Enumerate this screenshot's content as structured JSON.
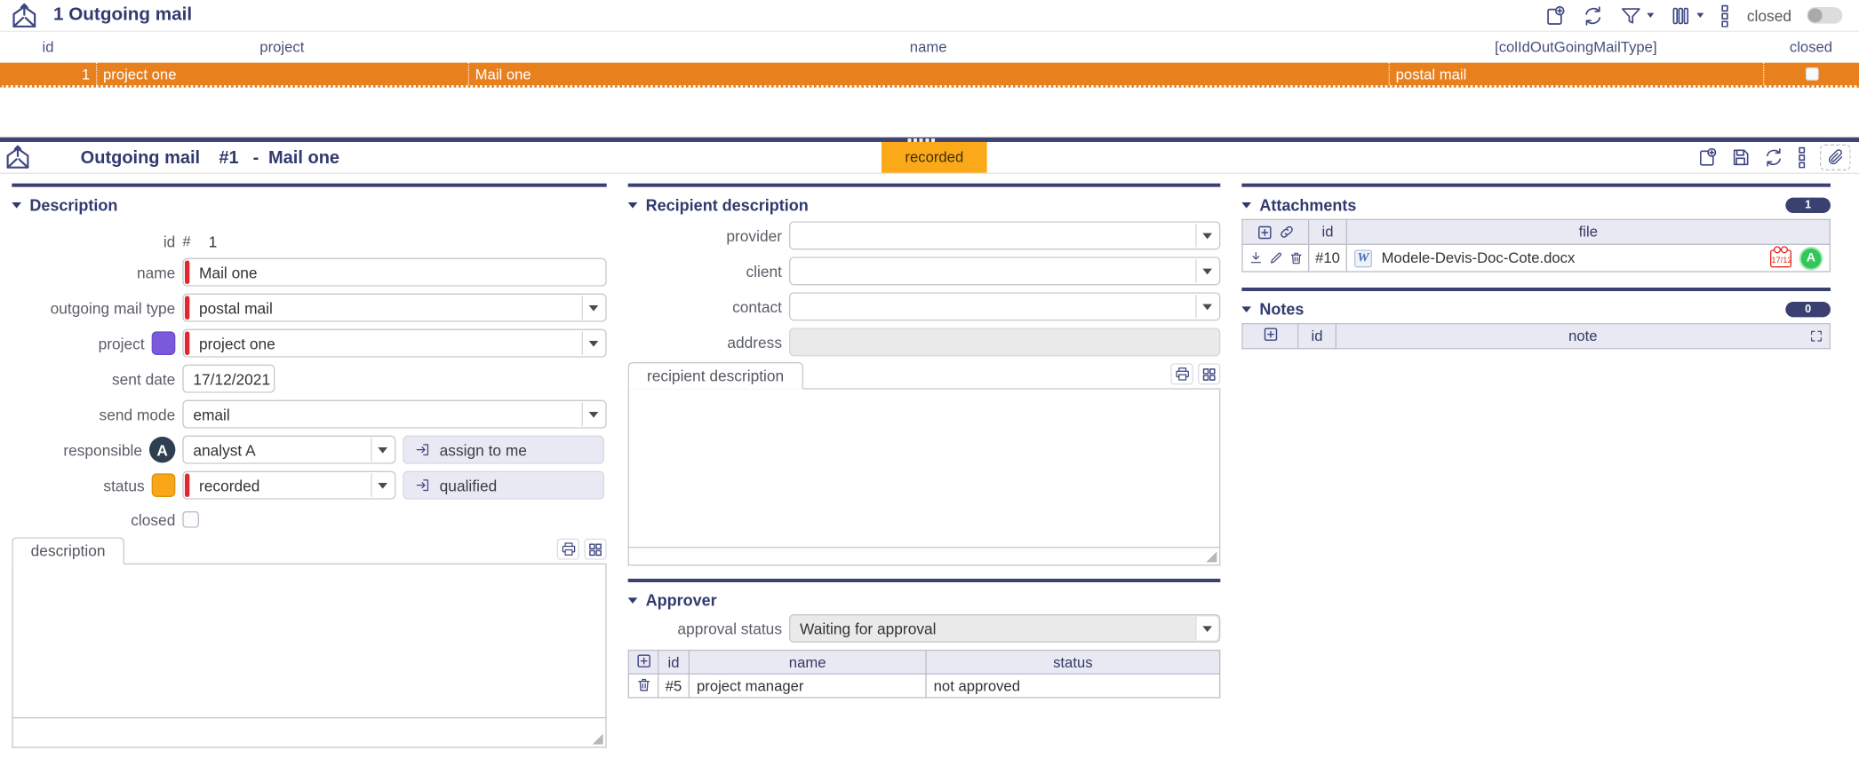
{
  "colors": {
    "accent_navy": "#3a4170",
    "row_orange": "#e8801e",
    "status_orange": "#fba919",
    "project_purple": "#7a5ad8",
    "avatar_green": "#33c759",
    "calendar_red": "#e02b20",
    "required_red": "#e0282e"
  },
  "list_view": {
    "title": "1 Outgoing mail",
    "toolbar": {
      "closed_label": "closed",
      "closed_toggle_on": false
    },
    "columns": [
      "id",
      "project",
      "name",
      "[colIdOutGoingMailType]",
      "closed"
    ],
    "row": {
      "id": "1",
      "project": "project one",
      "name": "Mail one",
      "mail_type": "postal mail",
      "closed": false
    }
  },
  "form_view": {
    "title_prefix": "Outgoing mail",
    "record_id": "#1",
    "title_separator": "-",
    "record_name": "Mail one",
    "status_badge": "recorded"
  },
  "description": {
    "title": "Description",
    "id_label": "id",
    "id_hash": "#",
    "id_value": "1",
    "name_label": "name",
    "name_value": "Mail one",
    "mail_type_label": "outgoing mail type",
    "mail_type_value": "postal mail",
    "project_label": "project",
    "project_value": "project one",
    "sent_date_label": "sent date",
    "sent_date_value": "17/12/2021",
    "send_mode_label": "send mode",
    "send_mode_value": "email",
    "responsible_label": "responsible",
    "responsible_value": "analyst A",
    "responsible_initial": "A",
    "assign_button": "assign to me",
    "status_label": "status",
    "status_value": "recorded",
    "qualified_button": "qualified",
    "closed_label": "closed",
    "closed_checked": false,
    "notebook_tab": "description"
  },
  "recipient": {
    "title": "Recipient description",
    "provider_label": "provider",
    "provider_value": "",
    "client_label": "client",
    "client_value": "",
    "contact_label": "contact",
    "contact_value": "",
    "address_label": "address",
    "address_value": "",
    "notebook_tab": "recipient description"
  },
  "approver": {
    "title": "Approver",
    "approval_status_label": "approval status",
    "approval_status_value": "Waiting for approval",
    "columns": {
      "id": "id",
      "name": "name",
      "status": "status"
    },
    "rows": [
      {
        "id": "#5",
        "name": "project manager",
        "status": "not approved"
      }
    ]
  },
  "attachments": {
    "title": "Attachments",
    "count_badge": "1",
    "columns": {
      "id": "id",
      "file": "file"
    },
    "rows": [
      {
        "id": "#10",
        "file": "Modele-Devis-Doc-Cote.docx",
        "file_type_letter": "W",
        "date_badge": "17/12",
        "user_initial": "A"
      }
    ]
  },
  "notes": {
    "title": "Notes",
    "count_badge": "0",
    "columns": {
      "id": "id",
      "note": "note"
    }
  },
  "icons": {
    "new_record": "page-plus",
    "refresh": "circular-arrows",
    "filter": "funnel",
    "columns_picker": "vertical-bars",
    "more_menu": "stacked-squares",
    "save": "floppy-disk",
    "attachment": "paperclip",
    "print": "printer",
    "expand": "grid-squares",
    "add": "plus-box",
    "link": "chain",
    "download": "down-arrow",
    "edit": "pencil",
    "delete": "trash",
    "fullscreen": "corner-brackets",
    "app": "open-envelope-arrow"
  }
}
